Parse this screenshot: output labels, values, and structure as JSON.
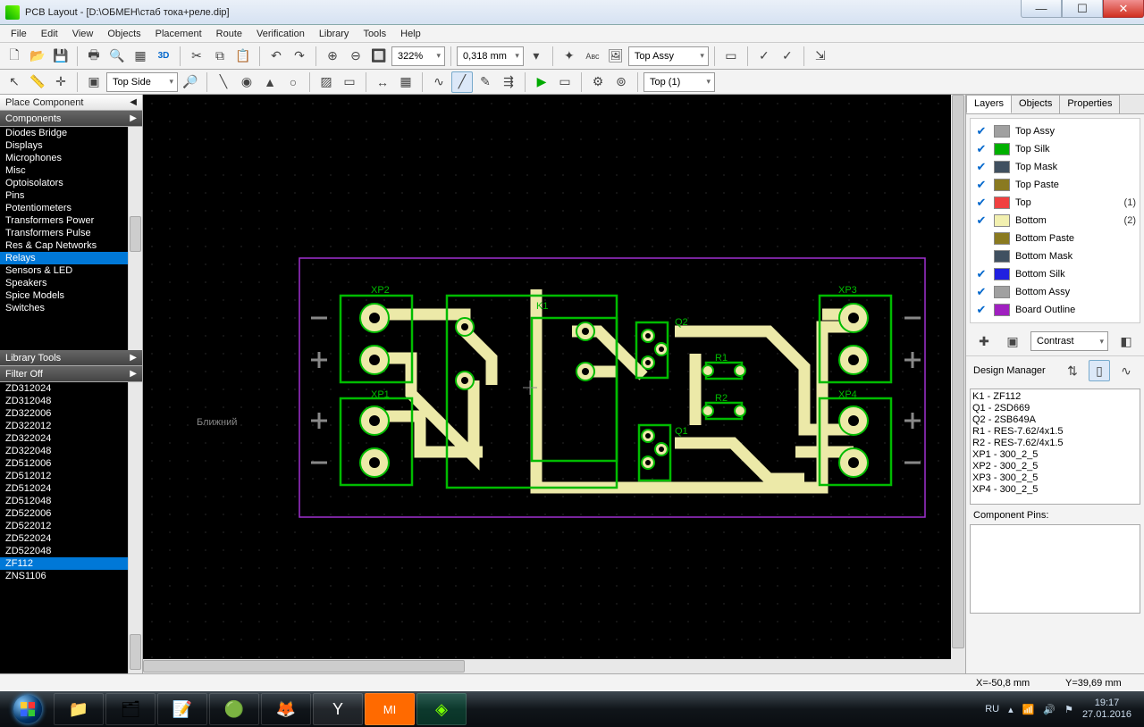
{
  "title": "PCB Layout - [D:\\ОБМЕН\\стаб тока+реле.dip]",
  "menus": [
    "File",
    "Edit",
    "View",
    "Objects",
    "Placement",
    "Route",
    "Verification",
    "Library",
    "Tools",
    "Help"
  ],
  "toolbar": {
    "zoom": "322%",
    "grid": "0,318 mm",
    "td": "3D",
    "layer": "Top Assy",
    "side": "Top Side",
    "top": "Top (1)"
  },
  "left": {
    "place": "Place Component",
    "comp_hdr": "Components",
    "components": [
      "Diodes Bridge",
      "Displays",
      "Microphones",
      "Misc",
      "Optoisolators",
      "Pins",
      "Potentiometers",
      "Transformers Power",
      "Transformers Pulse",
      "Res & Cap Networks",
      "Relays",
      "Sensors & LED",
      "Speakers",
      "Spice Models",
      "Switches"
    ],
    "libtools": "Library Tools",
    "filteroff": "Filter Off",
    "parts": [
      "ZD312024",
      "ZD312048",
      "ZD322006",
      "ZD322012",
      "ZD322024",
      "ZD322048",
      "ZD512006",
      "ZD512012",
      "ZD512024",
      "ZD512048",
      "ZD522006",
      "ZD522012",
      "ZD522024",
      "ZD522048",
      "ZF112",
      "ZNS1106"
    ]
  },
  "right": {
    "tabs": [
      "Layers",
      "Objects",
      "Properties"
    ],
    "layers": [
      {
        "c": "#a0a0a0",
        "n": "Top Assy",
        "on": true
      },
      {
        "c": "#00b000",
        "n": "Top Silk",
        "on": true
      },
      {
        "c": "#405060",
        "n": "Top Mask",
        "on": true
      },
      {
        "c": "#8a7a20",
        "n": "Top Paste",
        "on": true
      },
      {
        "c": "#f04040",
        "n": "Top",
        "on": true,
        "num": "(1)"
      },
      {
        "c": "#f2f0b0",
        "n": "Bottom",
        "on": true,
        "num": "(2)"
      },
      {
        "c": "#8a7a20",
        "n": "Bottom Paste",
        "on": false
      },
      {
        "c": "#405060",
        "n": "Bottom Mask",
        "on": false
      },
      {
        "c": "#2020e0",
        "n": "Bottom Silk",
        "on": true
      },
      {
        "c": "#a0a0a0",
        "n": "Bottom Assy",
        "on": true
      },
      {
        "c": "#a020c0",
        "n": "Board Outline",
        "on": true
      }
    ],
    "contrast": "Contrast",
    "designmgr": "Design Manager",
    "components": [
      "K1 - ZF112",
      "Q1 - 2SD669",
      "Q2 - 2SB649A",
      "R1 - RES-7.62/4x1.5",
      "R2 - RES-7.62/4x1.5",
      "XP1 - 300_2_5",
      "XP2 - 300_2_5",
      "XP3 - 300_2_5",
      "XP4 - 300_2_5"
    ],
    "pins": "Component Pins:"
  },
  "canvas": {
    "label": "Ближний",
    "refs": {
      "xp1": "XP1",
      "xp2": "XP2",
      "xp3": "XP3",
      "xp4": "XP4",
      "k1": "K1",
      "q1": "Q1",
      "q2": "Q2",
      "r1": "R1",
      "r2": "R2"
    }
  },
  "status": {
    "x": "X=-50,8 mm",
    "y": "Y=39,69 mm"
  },
  "task": {
    "lang": "RU",
    "time": "19:17",
    "date": "27.01.2016"
  }
}
